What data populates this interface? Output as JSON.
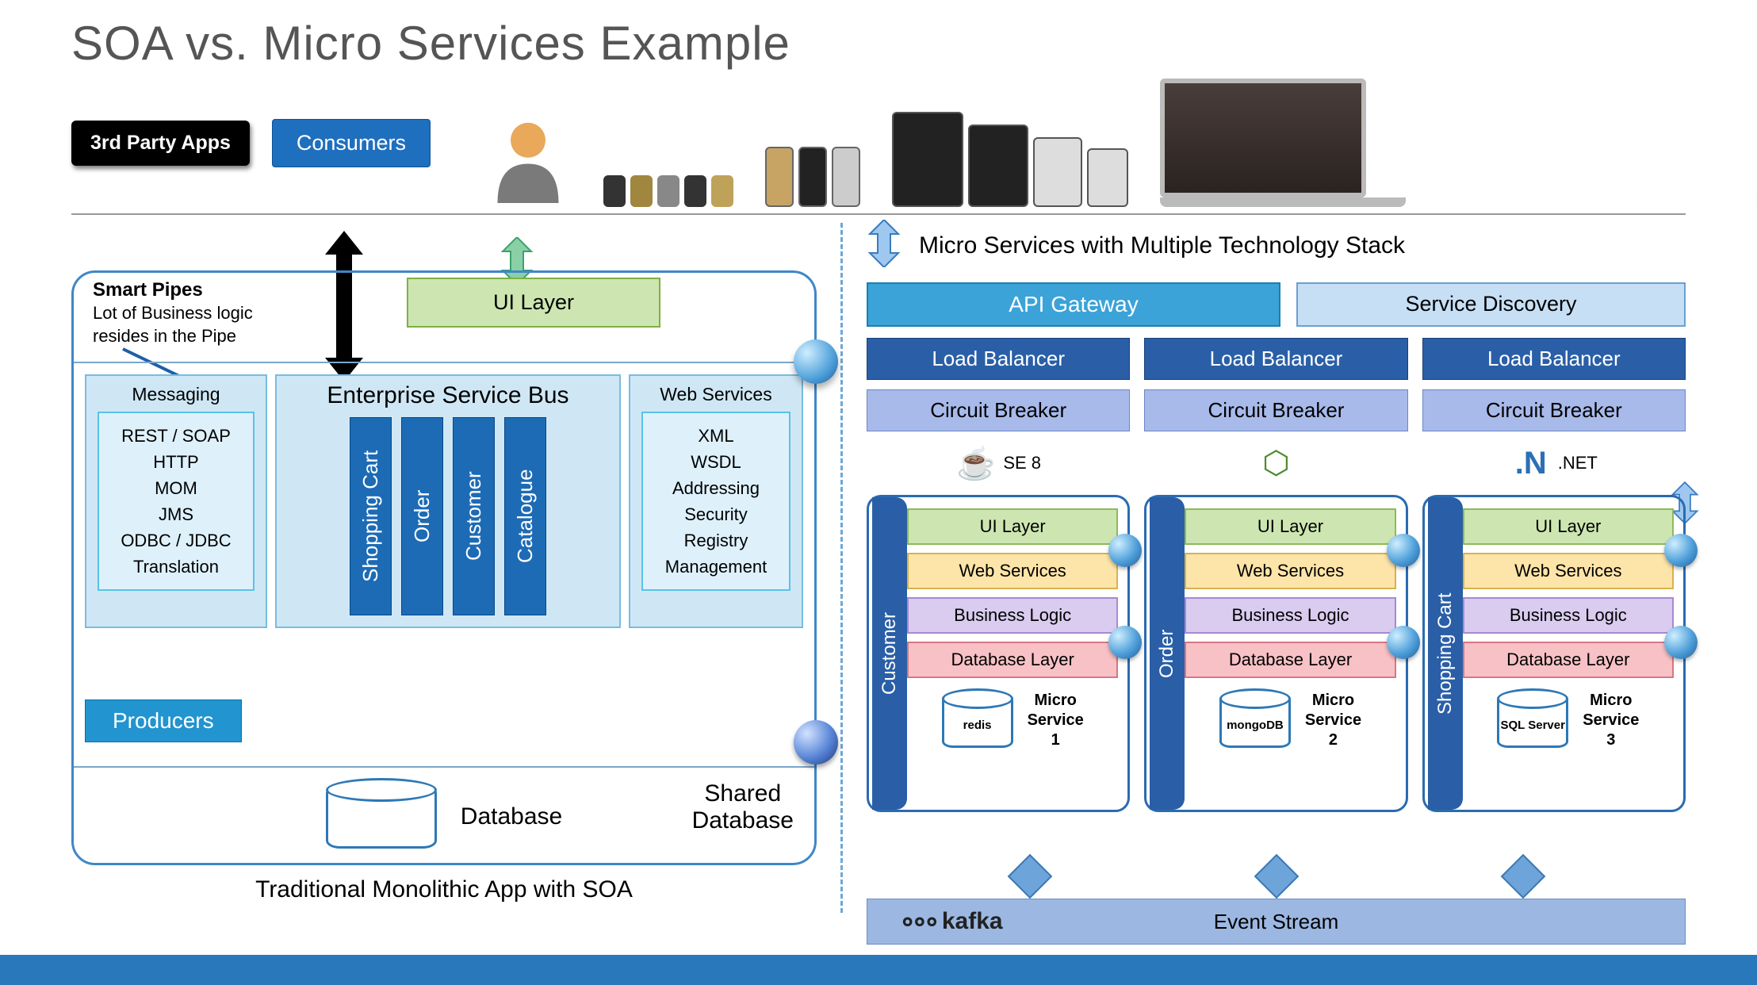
{
  "title": "SOA vs. Micro Services Example",
  "header": {
    "third_party": "3rd Party Apps",
    "consumers": "Consumers"
  },
  "left": {
    "smart_pipes_title": "Smart Pipes",
    "smart_pipes_desc1": "Lot of Business logic",
    "smart_pipes_desc2": "resides in the Pipe",
    "ui_layer": "UI Layer",
    "messaging_title": "Messaging",
    "messaging_items": [
      "REST / SOAP",
      "HTTP",
      "MOM",
      "JMS",
      "ODBC / JDBC",
      "Translation"
    ],
    "esb_title": "Enterprise Service Bus",
    "esb_cols": [
      "Shopping Cart",
      "Order",
      "Customer",
      "Catalogue"
    ],
    "web_title": "Web Services",
    "web_items": [
      "XML",
      "WSDL",
      "Addressing",
      "Security",
      "Registry",
      "Management"
    ],
    "producers": "Producers",
    "database": "Database",
    "shared_db": "Shared Database",
    "caption": "Traditional Monolithic App with SOA"
  },
  "right": {
    "title": "Micro Services with Multiple Technology Stack",
    "api_gateway": "API Gateway",
    "service_discovery": "Service Discovery",
    "load_balancer": "Load Balancer",
    "circuit_breaker": "Circuit Breaker",
    "techs": [
      "SE 8",
      "",
      ".NET"
    ],
    "tech_icons": [
      "java-icon",
      "nodejs-icon",
      "dotnet-icon"
    ],
    "ms_names": [
      "Customer",
      "Order",
      "Shopping Cart"
    ],
    "layers": {
      "ui": "UI Layer",
      "ws": "Web Services",
      "bl": "Business Logic",
      "db": "Database Layer"
    },
    "dbs": [
      "redis",
      "mongoDB",
      "SQL Server"
    ],
    "ms_labels": [
      "Micro Service 1",
      "Micro Service 2",
      "Micro Service 3"
    ],
    "kafka": "kafka",
    "event_stream": "Event Stream"
  }
}
